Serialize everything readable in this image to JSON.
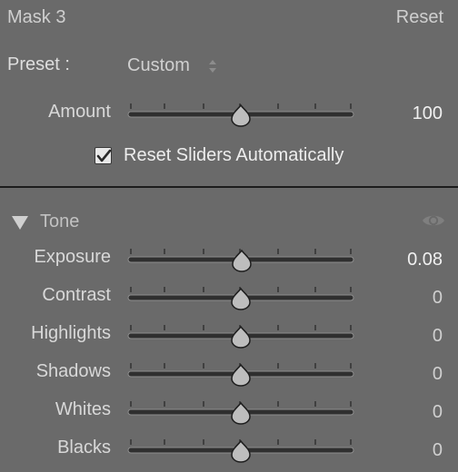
{
  "header": {
    "mask_name": "Mask 3",
    "reset_label": "Reset"
  },
  "preset": {
    "label": "Preset :",
    "value": "Custom"
  },
  "amount": {
    "label": "Amount",
    "value": "100",
    "position": 0.5
  },
  "reset_sliders": {
    "label": "Reset Sliders Automatically",
    "checked": true
  },
  "tone": {
    "title": "Tone",
    "sliders": [
      {
        "label": "Exposure",
        "value": "0.08",
        "position": 0.504
      },
      {
        "label": "Contrast",
        "value": "0",
        "position": 0.5
      },
      {
        "label": "Highlights",
        "value": "0",
        "position": 0.5
      },
      {
        "label": "Shadows",
        "value": "0",
        "position": 0.5
      },
      {
        "label": "Whites",
        "value": "0",
        "position": 0.5
      },
      {
        "label": "Blacks",
        "value": "0",
        "position": 0.5
      }
    ]
  },
  "icons": {
    "updown": "up-down-arrows-icon",
    "checkmark": "checkmark-icon",
    "collapse": "triangle-down-icon",
    "visibility": "eye-icon"
  }
}
